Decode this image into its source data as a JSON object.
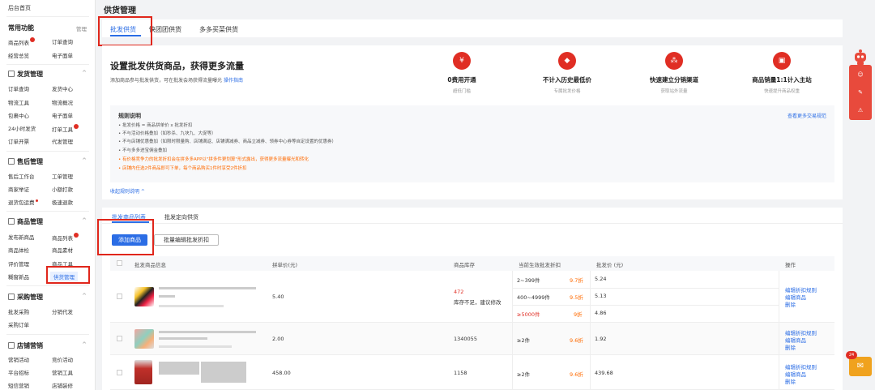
{
  "sidebar": {
    "home": "后台首页",
    "sections": [
      {
        "title": "常用功能",
        "action": "管理",
        "items": [
          "商品列表",
          "订单查询",
          "经营总览",
          "电子面单"
        ]
      },
      {
        "title": "发货管理",
        "items": [
          "订单查询",
          "发货中心",
          "物流工具",
          "物流概况",
          "包裹中心",
          "电子面单",
          "24小时发货",
          "打单工具",
          "订单开票",
          "代发管理"
        ]
      },
      {
        "title": "售后管理",
        "items": [
          "售后工作台",
          "工单管理",
          "商家举证",
          "小额打款",
          "退货包运费",
          "极速退款"
        ]
      },
      {
        "title": "商品管理",
        "items": [
          "发布新商品",
          "商品列表",
          "商品体检",
          "商品素材",
          "评价管理",
          "商品工具",
          "糊窗新品",
          "供货管理"
        ]
      },
      {
        "title": "采购管理",
        "items": [
          "批发采购",
          "分销代发",
          "采购订单"
        ]
      },
      {
        "title": "店铺营销",
        "items": [
          "营销活动",
          "竞价活动",
          "平台招标",
          "营销工具",
          "短信营销",
          "店铺装修"
        ]
      }
    ]
  },
  "page": {
    "title": "供货管理"
  },
  "tabs": [
    "批发供货",
    "快团团供货",
    "多多买菜供货"
  ],
  "promo": {
    "title": "设置批发供货商品，获得更多流量",
    "subtitle": "添加商品参与批发供货，可在批发会场获得流量曝光",
    "guide_link": "操作指南",
    "features": [
      {
        "title": "0费用开通",
        "sub": "超低门槛",
        "icon": "yuan-icon"
      },
      {
        "title": "不计入历史最低价",
        "sub": "专属批发价格",
        "icon": "diamond-icon"
      },
      {
        "title": "快速建立分销渠道",
        "sub": "获取站外流量",
        "icon": "network-icon"
      },
      {
        "title": "商品销量1:1计入主站",
        "sub": "快速提升商品权重",
        "icon": "chart-icon"
      }
    ]
  },
  "rules": {
    "title": "规则说明",
    "more_link": "查看更多交易规范",
    "lines": [
      "• 批发价格 = 商品拼单价 x 批发折扣",
      "• 不与活动价格叠加（如秒杀、九块九、大促等）",
      "• 不与店铺优惠叠加（如限时限量购、店铺满返、店铺满减券、商品立减券、领券中心券等自定设置的优惠券）",
      "• 不与多多进宝佣金叠加",
      "• 有价格竞争力的批发折扣会在拼多多APP以\"拼多件更划算\"形式露出，获得更多流量曝光和转化",
      "• 店铺内任选2件商品即可下单，每个商品购买1件时享受2件折扣"
    ],
    "collapse": "收起规则说明 ^"
  },
  "list": {
    "tabs": [
      "批发商品列表",
      "批发定向供货"
    ],
    "add_button": "添加商品",
    "batch_button": "批量编辑批发折扣",
    "headers": [
      "批发商品信息",
      "拼单价(元)",
      "商品库存",
      "当前生效批发折扣",
      "批发价 (元)",
      "操作"
    ],
    "rows": [
      {
        "price": "5.40",
        "stock": "472",
        "stock_warn": "库存不足，建议修改",
        "tiers": [
          {
            "range": "2~399件",
            "discount": "9.7折",
            "wprice": "5.24"
          },
          {
            "range": "400~4999件",
            "discount": "9.5折",
            "wprice": "5.13"
          },
          {
            "range": "≥5000件",
            "discount": "9折",
            "wprice": "4.86"
          }
        ],
        "ops": [
          "编辑折扣规则",
          "编辑商品",
          "删除"
        ]
      },
      {
        "price": "2.00",
        "stock": "1340055",
        "tiers": [
          {
            "range": "≥2件",
            "discount": "9.6折",
            "wprice": "1.92"
          }
        ],
        "ops": [
          "编辑折扣规则",
          "编辑商品",
          "删除"
        ]
      },
      {
        "price": "458.00",
        "stock": "1158",
        "tiers": [
          {
            "range": "≥2件",
            "discount": "9.6折",
            "wprice": "439.68"
          }
        ],
        "ops": [
          "编辑折扣规则",
          "编辑商品",
          "删除"
        ]
      }
    ]
  },
  "float": {
    "mail_badge": "24"
  },
  "colors": {
    "accent": "#2b6de5",
    "danger": "#e02e24",
    "warning": "#ff6a00",
    "annotation": "#e0261b"
  }
}
